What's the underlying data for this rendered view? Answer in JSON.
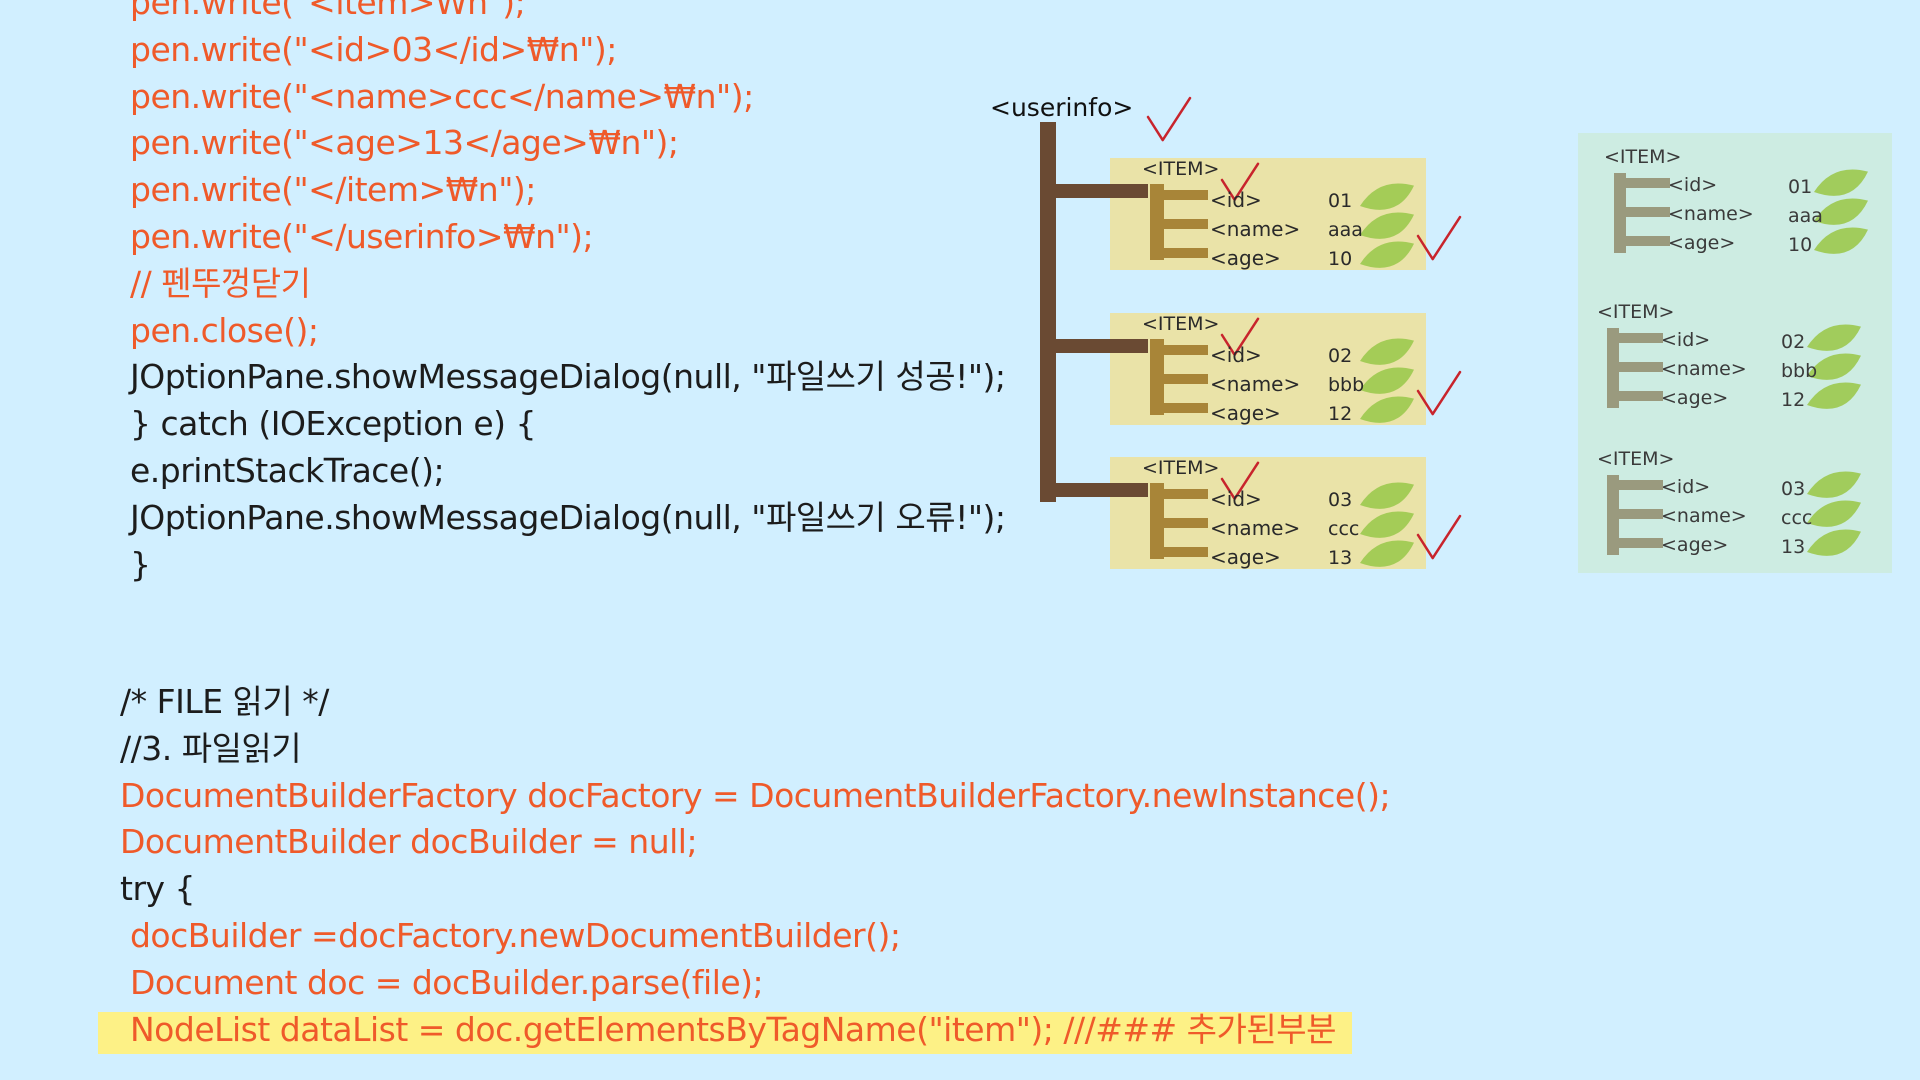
{
  "code": {
    "upper_lines": [
      {
        "text": "pen.write(\"<item>₩n\");",
        "color": "red"
      },
      {
        "text": "pen.write(\"<id>03</id>₩n\");",
        "color": "red"
      },
      {
        "text": "pen.write(\"<name>ccc</name>₩n\");",
        "color": "red"
      },
      {
        "text": "pen.write(\"<age>13</age>₩n\");",
        "color": "red"
      },
      {
        "text": "pen.write(\"</item>₩n\");",
        "color": "red"
      },
      {
        "text": "pen.write(\"</userinfo>₩n\");",
        "color": "red"
      },
      {
        "text": "// 펜뚜껑닫기",
        "color": "red"
      },
      {
        "text": "pen.close();",
        "color": "red"
      },
      {
        "text": "JOptionPane.showMessageDialog(null, \"파일쓰기 성공!\");",
        "color": "dark"
      },
      {
        "text": "} catch (IOException e) {",
        "color": "dark"
      },
      {
        "text": "e.printStackTrace();",
        "color": "dark"
      },
      {
        "text": "JOptionPane.showMessageDialog(null, \"파일쓰기 오류!\");",
        "color": "dark"
      },
      {
        "text": "}",
        "color": "dark"
      }
    ],
    "lower_lines": [
      {
        "text": "/* FILE 읽기 */",
        "color": "dark"
      },
      {
        "text": "//3. 파일읽기",
        "color": "dark"
      },
      {
        "text": "DocumentBuilderFactory docFactory = DocumentBuilderFactory.newInstance();",
        "color": "red"
      },
      {
        "text": "DocumentBuilder docBuilder = null;",
        "color": "red"
      },
      {
        "text": "try {",
        "color": "dark"
      },
      {
        "text": " docBuilder =docFactory.newDocumentBuilder();",
        "color": "red"
      },
      {
        "text": " Document doc = docBuilder.parse(file);",
        "color": "red"
      },
      {
        "text": " NodeList dataList = doc.getElementsByTagName(\"item\"); ///### 추가된부분",
        "color": "red",
        "highlight": true
      }
    ]
  },
  "diagram": {
    "root_label": "<userinfo>",
    "item_label": "<ITEM>",
    "field_labels": [
      "<id>",
      "<name>",
      "<age>"
    ],
    "items": [
      {
        "values": [
          "01",
          "aaa",
          "10"
        ]
      },
      {
        "values": [
          "02",
          "bbb",
          "12"
        ]
      },
      {
        "values": [
          "03",
          "ccc",
          "13"
        ]
      }
    ]
  },
  "colors": {
    "background": "#d1efff",
    "code_red": "#ef5a2a",
    "code_dark": "#1c1c1c",
    "highlight": "#fdf186",
    "item_box": "#eae3a8",
    "trunk": "#6a4a33",
    "branch": "#a88538",
    "leaf": "#9cc94e",
    "check": "#c8242c",
    "panel": "#cdece2",
    "panel_branch": "#9a9a7e"
  }
}
